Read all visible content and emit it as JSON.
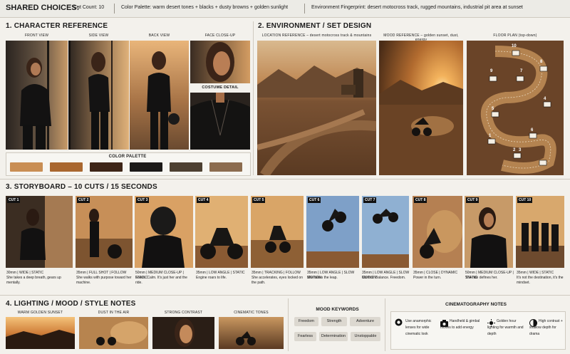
{
  "header": {
    "title": "SHARED CHOICES:",
    "cut_count": "Cut Count: 10",
    "palette": "Color Palette: warm desert tones + blacks + dusty browns + golden sunlight",
    "fingerprint": "Environment Fingerprint: desert motocross track, rugged mountains, industrial pit area at sunset"
  },
  "character": {
    "title": "1.  CHARACTER REFERENCE",
    "front": "FRONT VIEW",
    "side": "SIDE VIEW",
    "back": "BACK VIEW",
    "face": "FACE CLOSE-UP",
    "costume": "COSTUME DETAIL",
    "palette_title": "COLOR PALETTE",
    "palette_colors": [
      "#c98e54",
      "#a9672f",
      "#3e2517",
      "#1c1a18",
      "#4d4031",
      "#8c6c4f"
    ]
  },
  "environment": {
    "title": "2.  ENVIRONMENT / SET DESIGN",
    "location": "LOCATION REFERENCE – desert motocross track & mountains",
    "mood": "MOOD REFERENCE – golden sunset, dust, energy",
    "floor": "FLOOR PLAN (top-down)",
    "floor_marks": [
      "1",
      "2",
      "3",
      "4",
      "5",
      "6",
      "7",
      "8",
      "9",
      "10"
    ]
  },
  "storyboard": {
    "title": "3.  STORYBOARD – 10 CUTS / 15 SECONDS",
    "cuts": [
      {
        "label": "CUT 1",
        "spec": "30mm | WIDE | STATIC",
        "desc": "She takes a deep breath, gears up mentally."
      },
      {
        "label": "CUT 2",
        "spec": "35mm | FULL SHOT | FOLLOW",
        "desc": "She walks with purpose toward her machine."
      },
      {
        "label": "CUT 3",
        "spec": "50mm | MEDIUM CLOSE-UP | STATIC",
        "desc": "Focus. Calm. It's just her and the ride."
      },
      {
        "label": "CUT 4",
        "spec": "35mm | LOW ANGLE | STATIC",
        "desc": "Engine roars to life."
      },
      {
        "label": "CUT 5",
        "spec": "35mm | TRACKING | FOLLOW",
        "desc": "She accelerates, eyes locked on the path."
      },
      {
        "label": "CUT 6",
        "spec": "35mm | LOW ANGLE | SLOW MOTION",
        "desc": "She takes the leap."
      },
      {
        "label": "CUT 7",
        "spec": "35mm | LOW ANGLE | SLOW MOTION",
        "desc": "Control. Balance. Freedom."
      },
      {
        "label": "CUT 8",
        "spec": "35mm | CLOSE | DYNAMIC",
        "desc": "Power in the turn."
      },
      {
        "label": "CUT 9",
        "spec": "50mm | MEDIUM CLOSE-UP | STATIC",
        "desc": "The ride defines her."
      },
      {
        "label": "CUT 10",
        "spec": "35mm | WIDE | STATIC",
        "desc": "It's not the destination, it's the mindset."
      }
    ]
  },
  "lighting": {
    "title": "4.  LIGHTING / MOOD / STYLE NOTES",
    "items": [
      "WARM GOLDEN SUNSET",
      "DUST IN THE AIR",
      "STRONG CONTRAST",
      "CINEMATIC TONES"
    ]
  },
  "mood": {
    "title": "MOOD KEYWORDS",
    "keywords": [
      "Freedom",
      "Strength",
      "Adventure",
      "Fearless",
      "Determination",
      "Unstoppable"
    ]
  },
  "cinematography": {
    "title": "CINEMATOGRAPHY NOTES",
    "notes": [
      {
        "icon": "lens-icon",
        "text": "Use anamorphic lenses for wide cinematic look"
      },
      {
        "icon": "camera-icon",
        "text": "Handheld & gimbal moves to add energy"
      },
      {
        "icon": "sun-icon",
        "text": "Golden hour lighting for warmth and depth"
      },
      {
        "icon": "contrast-icon",
        "text": "High contrast + shallow depth for drama"
      }
    ]
  }
}
